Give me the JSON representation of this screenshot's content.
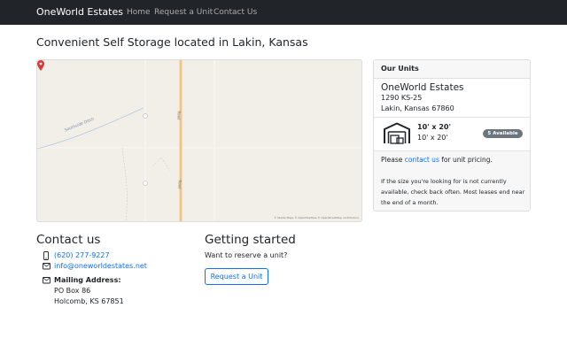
{
  "nav": {
    "brand": "OneWorld Estates",
    "links": [
      "Home",
      "Request a Unit",
      "Contact Us"
    ]
  },
  "page_title": "Convenient Self Storage located in Lakin, Kansas",
  "map": {
    "ditch_label": "Southside Ditch",
    "road_label_1": "Road",
    "road_label_2": "Road",
    "credit": "© Stadia Maps © OpenMapTiles © OpenStreetMap contributors"
  },
  "units": {
    "header": "Our Units",
    "location_name": "OneWorld Estates",
    "address_line1": "1290 KS-25",
    "address_line2": "Lakin, Kansas 67860",
    "unit": {
      "size": "10' x 20'",
      "dimensions": "10' x 20'",
      "badge": "5 Available"
    },
    "pricing_prefix": "Please ",
    "pricing_link": "contact us",
    "pricing_suffix": " for unit pricing.",
    "note": "If the size you're looking for is not currently available, check back often. Most leases end near the end of a month."
  },
  "contact": {
    "title": "Contact us",
    "phone": "(620) 277-9227",
    "email": "info@oneworldestates.net",
    "mailing_label": "Mailing Address:",
    "mailing_line1": "PO Box 86",
    "mailing_line2": "Holcomb, KS 67851"
  },
  "getting_started": {
    "title": "Getting started",
    "text": "Want to reserve a unit?",
    "button": "Request a Unit"
  },
  "colors": {
    "navbar": "#212529",
    "link": "#0d6efd",
    "badge": "#6c757d",
    "map_pin": "#d63a3a"
  }
}
